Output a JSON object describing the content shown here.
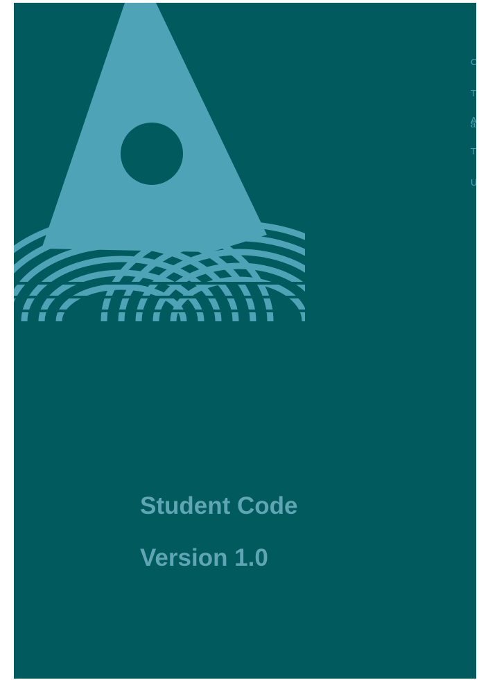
{
  "cover": {
    "title": "Student Code",
    "version": "Version 1.0",
    "edge_text_block_1": [
      "C",
      "T",
      "a"
    ],
    "edge_text_block_2": [
      "A",
      "T",
      "U"
    ]
  },
  "colors": {
    "background": "#015b5e",
    "logo": "#4ea3b6",
    "title": "#5fa5b3"
  },
  "logo_icon": "triangle-sun-waves-logo"
}
